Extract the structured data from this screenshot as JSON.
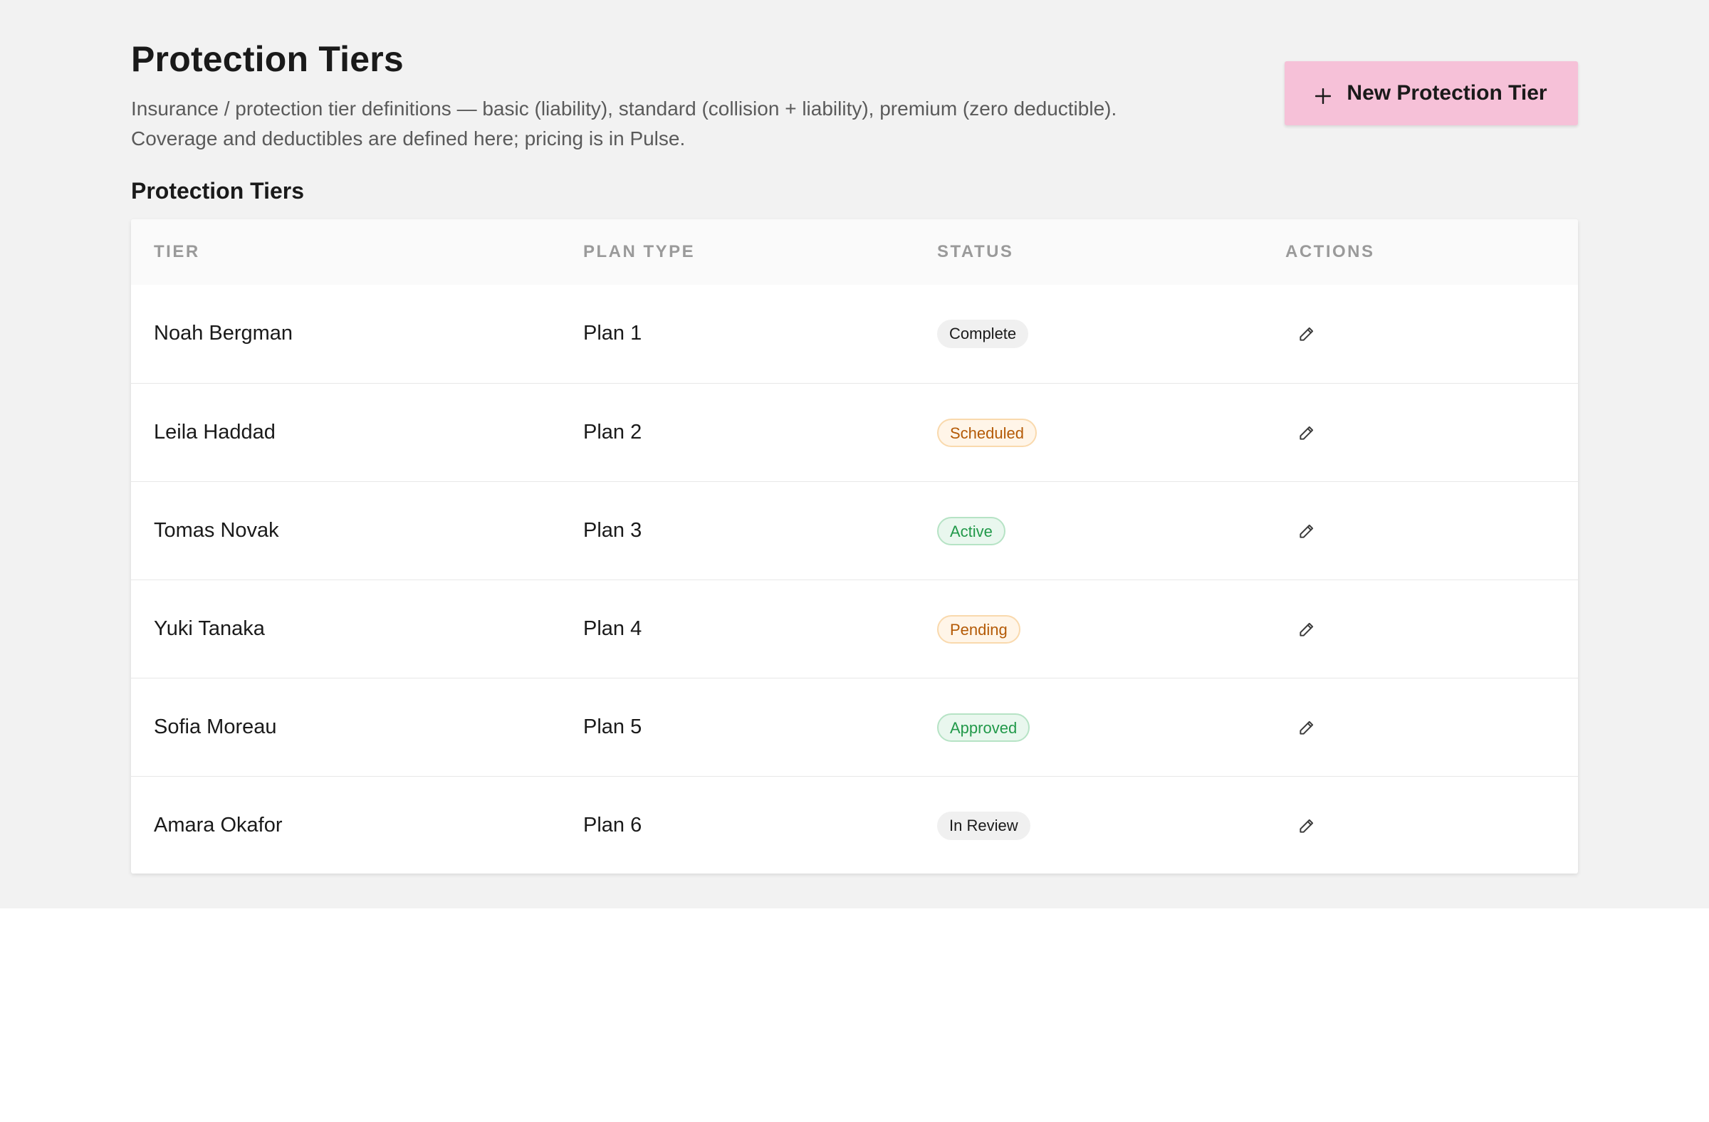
{
  "header": {
    "title": "Protection Tiers",
    "description_line1": "Insurance / protection tier definitions — basic (liability), standard (collision + liability), premium (zero deductible).",
    "description_line2": "Coverage and deductibles are defined here; pricing is in Pulse.",
    "new_button_label": "New Protection Tier",
    "new_button_icon": "plus-icon"
  },
  "section": {
    "title": "Protection Tiers"
  },
  "table": {
    "columns": [
      "TIER",
      "PLAN TYPE",
      "STATUS",
      "ACTIONS"
    ],
    "rows": [
      {
        "tier": "Noah Bergman",
        "plan": "Plan 1",
        "status": "Complete",
        "status_kind": "neutral",
        "action_icon": "pencil-icon"
      },
      {
        "tier": "Leila Haddad",
        "plan": "Plan 2",
        "status": "Scheduled",
        "status_kind": "warning",
        "action_icon": "pencil-icon"
      },
      {
        "tier": "Tomas Novak",
        "plan": "Plan 3",
        "status": "Active",
        "status_kind": "success",
        "action_icon": "pencil-icon"
      },
      {
        "tier": "Yuki Tanaka",
        "plan": "Plan 4",
        "status": "Pending",
        "status_kind": "warning",
        "action_icon": "pencil-icon"
      },
      {
        "tier": "Sofia Moreau",
        "plan": "Plan 5",
        "status": "Approved",
        "status_kind": "success",
        "action_icon": "pencil-icon"
      },
      {
        "tier": "Amara Okafor",
        "plan": "Plan 6",
        "status": "In Review",
        "status_kind": "neutral",
        "action_icon": "pencil-icon"
      }
    ]
  },
  "colors": {
    "page_background": "#f2f2f2",
    "primary_button": "#f6c1d8",
    "status_success": "#22994a",
    "status_warning": "#b45a06"
  }
}
